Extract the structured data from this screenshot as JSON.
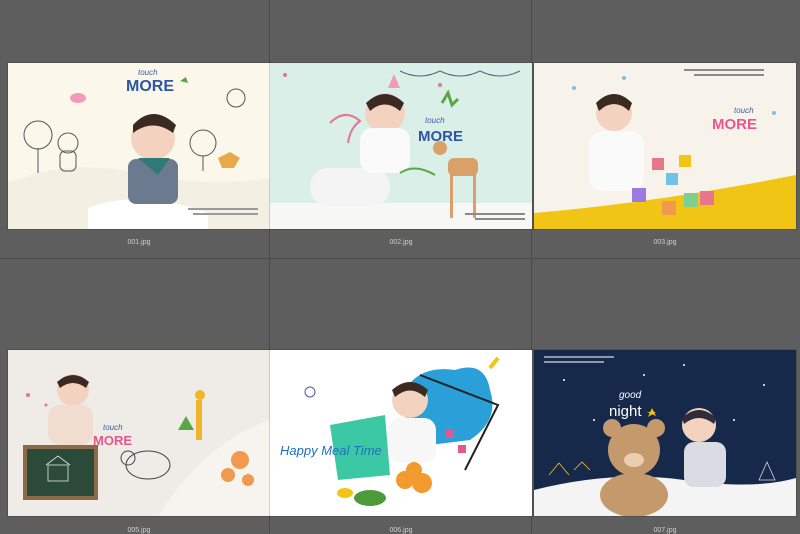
{
  "files": [
    {
      "name": "001.jpg",
      "title_small": "touch",
      "title_big": "MORE",
      "bg": "#fbf7ea"
    },
    {
      "name": "002.jpg",
      "title_small": "touch",
      "title_big": "MORE",
      "bg": "#d9efe8"
    },
    {
      "name": "003.jpg",
      "title_small": "touch",
      "title_big": "MORE",
      "bg": "#f8f3ea"
    },
    {
      "name": "005.jpg",
      "title_small": "touch",
      "title_big": "MORE",
      "bg": "#efebe6"
    },
    {
      "name": "006.jpg",
      "title_main": "Happy Meal Time",
      "bg": "#ffffff"
    },
    {
      "name": "007.jpg",
      "title_small": "good",
      "title_big": "night",
      "bg": "#17294a"
    }
  ],
  "colors": {
    "app_bg": "#5e5e5e",
    "divider": "#4a4a4a",
    "label": "#cfcfcf",
    "accent_pink": "#e8578b",
    "accent_yellow": "#f1c515",
    "navy": "#17294a"
  }
}
